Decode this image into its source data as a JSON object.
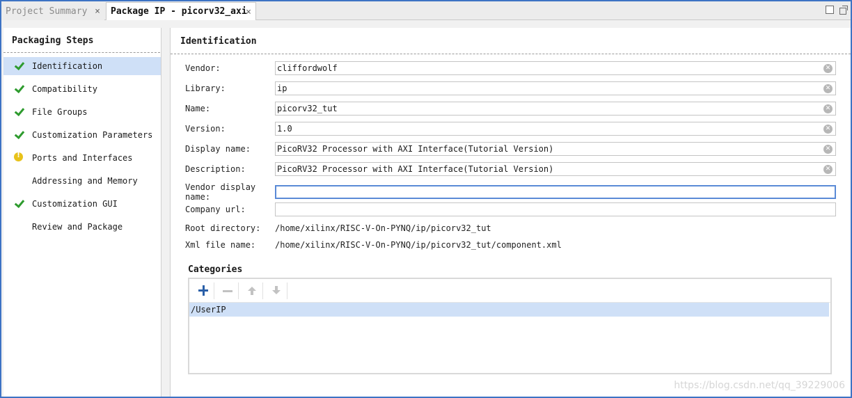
{
  "tabs": [
    {
      "label": "Project Summary",
      "close": "×"
    },
    {
      "label": "Package IP - picorv32_axi",
      "close": "×"
    }
  ],
  "window_icons": [
    "maximize-icon",
    "restore-icon"
  ],
  "sidebar": {
    "title": "Packaging Steps",
    "items": [
      {
        "label": "Identification",
        "status": "check",
        "selected": true
      },
      {
        "label": "Compatibility",
        "status": "check"
      },
      {
        "label": "File Groups",
        "status": "check"
      },
      {
        "label": "Customization Parameters",
        "status": "check"
      },
      {
        "label": "Ports and Interfaces",
        "status": "warning"
      },
      {
        "label": "Addressing and Memory",
        "status": "none"
      },
      {
        "label": "Customization GUI",
        "status": "check"
      },
      {
        "label": "Review and Package",
        "status": "none"
      }
    ]
  },
  "main": {
    "title": "Identification",
    "fields": {
      "vendor": {
        "label": "Vendor:",
        "value": "cliffordwolf"
      },
      "library": {
        "label": "Library:",
        "value": "ip"
      },
      "name": {
        "label": "Name:",
        "value": "picorv32_tut"
      },
      "version": {
        "label": "Version:",
        "value": "1.0"
      },
      "display_name": {
        "label": "Display name:",
        "value": "PicoRV32 Processor with AXI Interface(Tutorial Version)"
      },
      "description": {
        "label": "Description:",
        "value": "PicoRV32 Processor with AXI Interface(Tutorial Version)"
      },
      "vendor_display_name": {
        "label": "Vendor display name:",
        "value": ""
      },
      "company_url": {
        "label": "Company url:",
        "value": ""
      }
    },
    "root_directory": {
      "label": "Root directory:",
      "value": "/home/xilinx/RISC-V-On-PYNQ/ip/picorv32_tut"
    },
    "xml_file_name": {
      "label": "Xml file name:",
      "value": "/home/xilinx/RISC-V-On-PYNQ/ip/picorv32_tut/component.xml"
    },
    "categories": {
      "title": "Categories",
      "items": [
        "/UserIP"
      ]
    }
  },
  "watermark": "https://blog.csdn.net/qq_39229006",
  "colors": {
    "accent": "#3d73c4",
    "selected": "#cfe0f7",
    "check": "#2e9b2e",
    "warning": "#e8c21a"
  }
}
